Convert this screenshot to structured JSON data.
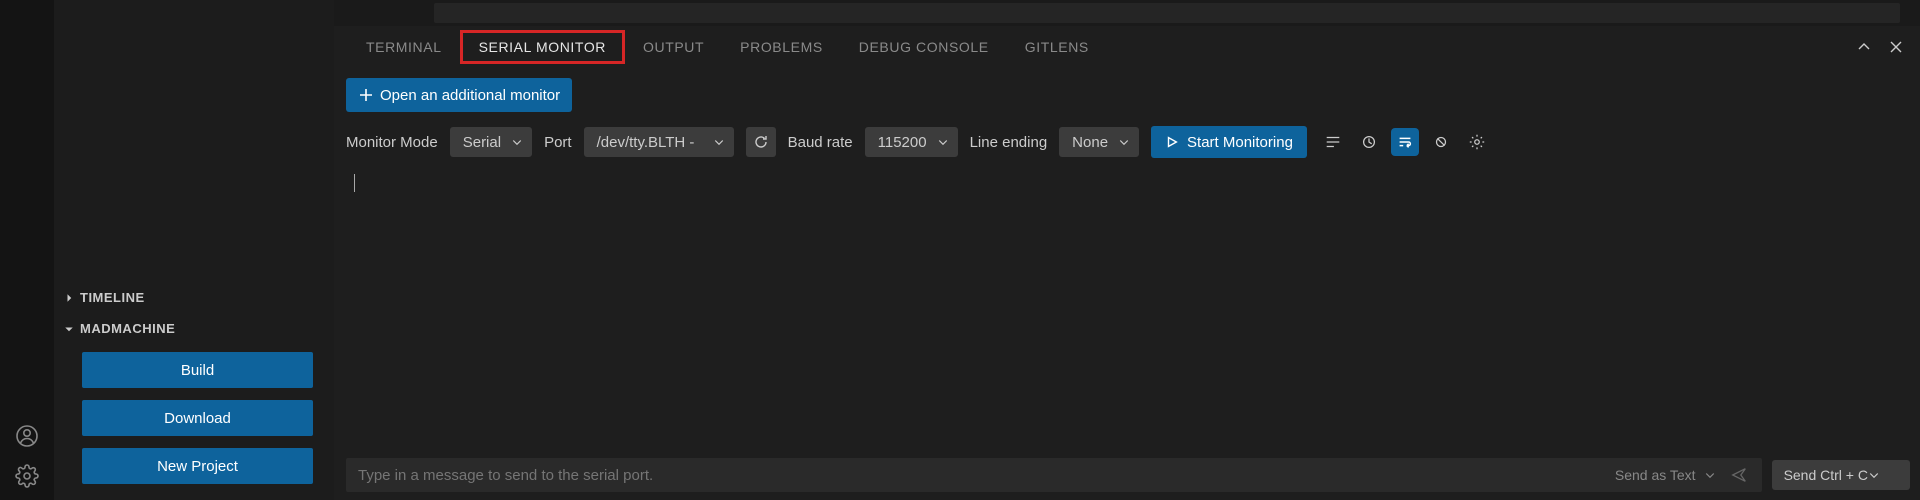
{
  "activity": {
    "accounts_icon": "accounts-icon",
    "settings_icon": "gear-icon"
  },
  "sidebar": {
    "timeline": {
      "label": "TIMELINE",
      "expanded": false
    },
    "madmachine": {
      "label": "MADMACHINE",
      "expanded": true,
      "buttons": {
        "build": "Build",
        "download": "Download",
        "new_project": "New Project"
      }
    }
  },
  "panel": {
    "tabs": {
      "terminal": "TERMINAL",
      "serial_monitor": "SERIAL MONITOR",
      "output": "OUTPUT",
      "problems": "PROBLEMS",
      "debug_console": "DEBUG CONSOLE",
      "gitlens": "GITLENS"
    },
    "actions": {
      "maximize": "maximize",
      "close": "close"
    }
  },
  "serial_monitor": {
    "open_additional": "Open an additional monitor",
    "monitor_mode_label": "Monitor Mode",
    "monitor_mode_value": "Serial",
    "port_label": "Port",
    "port_value": "/dev/tty.BLTH -",
    "baud_label": "Baud rate",
    "baud_value": "115200",
    "line_ending_label": "Line ending",
    "line_ending_value": "None",
    "start_button": "Start Monitoring",
    "input_placeholder": "Type in a message to send to the serial port.",
    "send_as_label": "Send as Text",
    "send_ctrl_label": "Send Ctrl + C"
  }
}
